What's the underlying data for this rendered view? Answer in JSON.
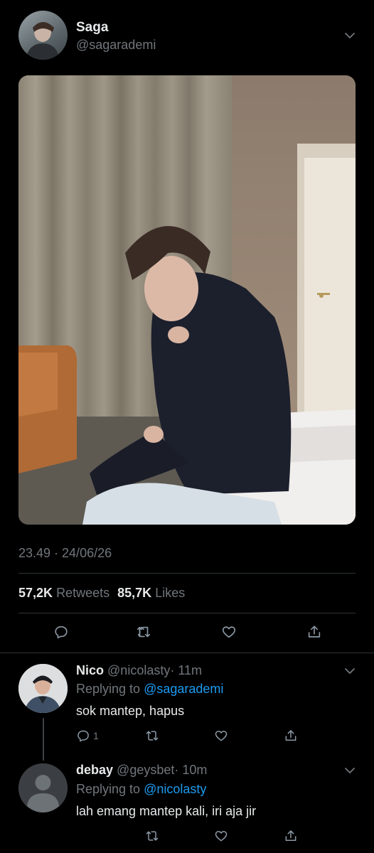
{
  "tweet": {
    "author_name": "Saga",
    "author_handle": "@sagarademi",
    "timestamp": "23.49 · 24/06/26",
    "retweets_count": "57,2K",
    "retweets_label": "Retweets",
    "likes_count": "85,7K",
    "likes_label": "Likes",
    "icons": [
      "reply-icon",
      "retweet-icon",
      "like-icon",
      "share-icon"
    ]
  },
  "replies": [
    {
      "name": "Nico",
      "handle": "@nicolasty",
      "time": "· 11m",
      "replying_label": "Replying to",
      "replying_to": "@sagarademi",
      "text": "sok mantep, hapus",
      "reply_count": "1"
    },
    {
      "name": "debay",
      "handle": "@geysbet",
      "time": "· 10m",
      "replying_label": "Replying to",
      "replying_to": "@nicolasty",
      "text": "lah emang mantep kali, iri aja jir"
    }
  ],
  "colors": {
    "background": "#000000",
    "text": "#e7e9ea",
    "muted": "#71767b",
    "link": "#1d9bf0"
  }
}
